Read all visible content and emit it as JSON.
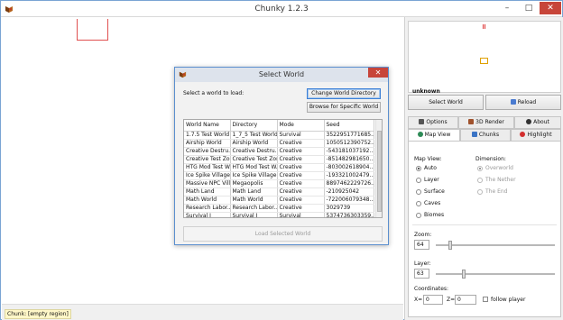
{
  "window": {
    "title": "Chunky 1.2.3",
    "minimize": "–",
    "maximize": "□",
    "close": "✕"
  },
  "status_bar": {
    "text": "Chunk: [empty region]"
  },
  "minimap": {
    "label": "unknown"
  },
  "buttons": {
    "select_world": "Select World",
    "reload": "Reload"
  },
  "tabs": {
    "row1": [
      {
        "label": "Options"
      },
      {
        "label": "3D Render"
      },
      {
        "label": "About"
      }
    ],
    "row2": [
      {
        "label": "Map View"
      },
      {
        "label": "Chunks"
      },
      {
        "label": "Highlight"
      }
    ]
  },
  "map_view": {
    "map_view_label": "Map View:",
    "dimension_label": "Dimension:",
    "modes": [
      "Auto",
      "Layer",
      "Surface",
      "Caves",
      "Biomes"
    ],
    "selected_mode": "Auto",
    "dimensions": [
      "Overworld",
      "The Nether",
      "The End"
    ],
    "zoom_label": "Zoom:",
    "zoom_value": "64",
    "layer_label": "Layer:",
    "layer_value": "63",
    "coordinates_label": "Coordinates:",
    "x_label": "X=",
    "x_value": "0",
    "z_label": "Z=",
    "z_value": "0",
    "follow_player": "follow player"
  },
  "dialog": {
    "title": "Select World",
    "close": "✕",
    "prompt": "Select a world to load:",
    "change_dir": "Change World Directory",
    "browse": "Browse for Specific World",
    "load": "Load Selected World",
    "columns": [
      "World Name",
      "Directory",
      "Mode",
      "Seed"
    ],
    "rows": [
      [
        "1.7.5 Test World",
        "1_7_5 Test World",
        "Survival",
        "3522951771685..."
      ],
      [
        "Airship World",
        "Airship World",
        "Creative",
        "1050512390752..."
      ],
      [
        "Creative Destru...",
        "Creative Destru...",
        "Creative",
        "-543181037192..."
      ],
      [
        "Creative Test Zone",
        "Creative Test Zone",
        "Creative",
        "-851482981650..."
      ],
      [
        "HTG Mod Test W...",
        "HTG Mod Test W...",
        "Creative",
        "-803002618904..."
      ],
      [
        "Ice Spike Village",
        "Ice Spike Village",
        "Creative",
        "-193321002479..."
      ],
      [
        "Massive NPC Vill...",
        "Megaopolis",
        "Creative",
        "8897462229726..."
      ],
      [
        "Math Land",
        "Math Land",
        "Creative",
        "-210925042"
      ],
      [
        "Math World",
        "Math World",
        "Creative",
        "-722006079348..."
      ],
      [
        "Research Labor...",
        "Research Labor...",
        "Creative",
        "3029739"
      ],
      [
        "Survival I",
        "Survival I",
        "Survival",
        "5374736303359..."
      ]
    ]
  },
  "colors": {
    "accent": "#3c7fd6",
    "close": "#c7453a",
    "region": "#e05050"
  }
}
